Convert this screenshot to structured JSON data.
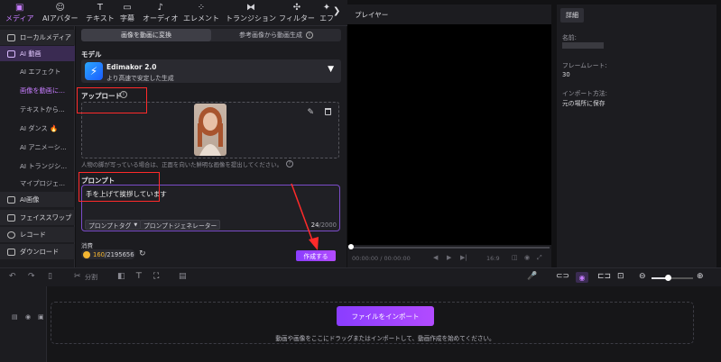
{
  "toolbar": {
    "tools": [
      {
        "icon": "media-icon",
        "glyph": "▣",
        "label": "メディア"
      },
      {
        "icon": "ai-avatar-icon",
        "glyph": "☺",
        "label": "AIアバター"
      },
      {
        "icon": "text-icon",
        "glyph": "T",
        "label": "テキスト"
      },
      {
        "icon": "caption-icon",
        "glyph": "▭",
        "label": "字幕"
      },
      {
        "icon": "audio-icon",
        "glyph": "♪",
        "label": "オーディオ"
      },
      {
        "icon": "element-icon",
        "glyph": "⁘",
        "label": "エレメント"
      },
      {
        "icon": "transition-icon",
        "glyph": "⧓",
        "label": "トランジション"
      },
      {
        "icon": "filter-icon",
        "glyph": "✣",
        "label": "フィルター"
      },
      {
        "icon": "effect-icon",
        "glyph": "✦",
        "label": "エフ"
      }
    ],
    "next_glyph": "❯"
  },
  "sidebar": {
    "items": [
      {
        "label": "ローカルメディア",
        "kind": "group"
      },
      {
        "label": "AI 動画",
        "kind": "group-selected"
      },
      {
        "label": "AI エフェクト",
        "kind": "sub"
      },
      {
        "label": "画像を動画に...",
        "kind": "sub-selected"
      },
      {
        "label": "テキストから...",
        "kind": "sub"
      },
      {
        "label": "AI ダンス 🔥",
        "kind": "sub"
      },
      {
        "label": "AI アニメーシ...",
        "kind": "sub"
      },
      {
        "label": "AI トランジシ...",
        "kind": "sub"
      },
      {
        "label": "マイプロジェ...",
        "kind": "sub"
      },
      {
        "label": "AI画像",
        "kind": "group"
      },
      {
        "label": "フェイススワップ",
        "kind": "group"
      },
      {
        "label": "レコード",
        "kind": "group"
      },
      {
        "label": "ダウンロード",
        "kind": "group"
      }
    ]
  },
  "panel": {
    "tabs": [
      "画像を動画に変換",
      "参考画像から動画生成"
    ],
    "model_label": "モデル",
    "model_name": "Edimakor 2.0",
    "model_desc": "より高速で安定した生成",
    "upload_label": "アップロード",
    "upload_hint": "人物の脚が写っている場合は、正面を向いた鮮明な画像を提出してください。",
    "prompt_label": "プロンプト",
    "prompt_value": "手を上げて挨拶しています",
    "prompt_tag_btn": "プロンプトタグ",
    "prompt_gen_btn": "プロンプトジェネレーター",
    "char_count": "24",
    "char_max": "/2000",
    "cost_label": "消費",
    "credits_used": "160",
    "credits_total": "/2195656",
    "create_btn": "作成する"
  },
  "player": {
    "title": "プレイヤー",
    "time_current": "00:00:00",
    "time_total": "/ 00:00:00",
    "aspect": "16:9"
  },
  "details": {
    "tab": "詳細",
    "name_label": "名前:",
    "fps_label": "フレームレート:",
    "fps_value": "30",
    "import_label": "インポート方法:",
    "import_value": "元の場所に保存"
  },
  "timeline_toolbar": {
    "split_label": "分割"
  },
  "timeline": {
    "import_btn": "ファイルをインポート",
    "drop_hint": "動画や画像をここにドラッグまたはインポートして、動画作成を始めてください。"
  },
  "colors": {
    "accent": "#c77dff",
    "button_gradient_start": "#8a3dff",
    "button_gradient_end": "#b24bff",
    "highlight_red": "#ff2a2a"
  }
}
